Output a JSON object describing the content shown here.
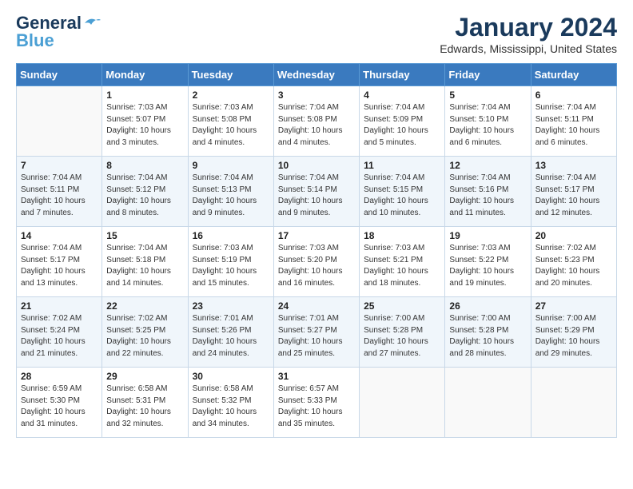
{
  "logo": {
    "line1": "General",
    "line2": "Blue"
  },
  "title": "January 2024",
  "location": "Edwards, Mississippi, United States",
  "days_header": [
    "Sunday",
    "Monday",
    "Tuesday",
    "Wednesday",
    "Thursday",
    "Friday",
    "Saturday"
  ],
  "weeks": [
    [
      {
        "day": "",
        "info": ""
      },
      {
        "day": "1",
        "info": "Sunrise: 7:03 AM\nSunset: 5:07 PM\nDaylight: 10 hours\nand 3 minutes."
      },
      {
        "day": "2",
        "info": "Sunrise: 7:03 AM\nSunset: 5:08 PM\nDaylight: 10 hours\nand 4 minutes."
      },
      {
        "day": "3",
        "info": "Sunrise: 7:04 AM\nSunset: 5:08 PM\nDaylight: 10 hours\nand 4 minutes."
      },
      {
        "day": "4",
        "info": "Sunrise: 7:04 AM\nSunset: 5:09 PM\nDaylight: 10 hours\nand 5 minutes."
      },
      {
        "day": "5",
        "info": "Sunrise: 7:04 AM\nSunset: 5:10 PM\nDaylight: 10 hours\nand 6 minutes."
      },
      {
        "day": "6",
        "info": "Sunrise: 7:04 AM\nSunset: 5:11 PM\nDaylight: 10 hours\nand 6 minutes."
      }
    ],
    [
      {
        "day": "7",
        "info": "Sunrise: 7:04 AM\nSunset: 5:11 PM\nDaylight: 10 hours\nand 7 minutes."
      },
      {
        "day": "8",
        "info": "Sunrise: 7:04 AM\nSunset: 5:12 PM\nDaylight: 10 hours\nand 8 minutes."
      },
      {
        "day": "9",
        "info": "Sunrise: 7:04 AM\nSunset: 5:13 PM\nDaylight: 10 hours\nand 9 minutes."
      },
      {
        "day": "10",
        "info": "Sunrise: 7:04 AM\nSunset: 5:14 PM\nDaylight: 10 hours\nand 9 minutes."
      },
      {
        "day": "11",
        "info": "Sunrise: 7:04 AM\nSunset: 5:15 PM\nDaylight: 10 hours\nand 10 minutes."
      },
      {
        "day": "12",
        "info": "Sunrise: 7:04 AM\nSunset: 5:16 PM\nDaylight: 10 hours\nand 11 minutes."
      },
      {
        "day": "13",
        "info": "Sunrise: 7:04 AM\nSunset: 5:17 PM\nDaylight: 10 hours\nand 12 minutes."
      }
    ],
    [
      {
        "day": "14",
        "info": "Sunrise: 7:04 AM\nSunset: 5:17 PM\nDaylight: 10 hours\nand 13 minutes."
      },
      {
        "day": "15",
        "info": "Sunrise: 7:04 AM\nSunset: 5:18 PM\nDaylight: 10 hours\nand 14 minutes."
      },
      {
        "day": "16",
        "info": "Sunrise: 7:03 AM\nSunset: 5:19 PM\nDaylight: 10 hours\nand 15 minutes."
      },
      {
        "day": "17",
        "info": "Sunrise: 7:03 AM\nSunset: 5:20 PM\nDaylight: 10 hours\nand 16 minutes."
      },
      {
        "day": "18",
        "info": "Sunrise: 7:03 AM\nSunset: 5:21 PM\nDaylight: 10 hours\nand 18 minutes."
      },
      {
        "day": "19",
        "info": "Sunrise: 7:03 AM\nSunset: 5:22 PM\nDaylight: 10 hours\nand 19 minutes."
      },
      {
        "day": "20",
        "info": "Sunrise: 7:02 AM\nSunset: 5:23 PM\nDaylight: 10 hours\nand 20 minutes."
      }
    ],
    [
      {
        "day": "21",
        "info": "Sunrise: 7:02 AM\nSunset: 5:24 PM\nDaylight: 10 hours\nand 21 minutes."
      },
      {
        "day": "22",
        "info": "Sunrise: 7:02 AM\nSunset: 5:25 PM\nDaylight: 10 hours\nand 22 minutes."
      },
      {
        "day": "23",
        "info": "Sunrise: 7:01 AM\nSunset: 5:26 PM\nDaylight: 10 hours\nand 24 minutes."
      },
      {
        "day": "24",
        "info": "Sunrise: 7:01 AM\nSunset: 5:27 PM\nDaylight: 10 hours\nand 25 minutes."
      },
      {
        "day": "25",
        "info": "Sunrise: 7:00 AM\nSunset: 5:28 PM\nDaylight: 10 hours\nand 27 minutes."
      },
      {
        "day": "26",
        "info": "Sunrise: 7:00 AM\nSunset: 5:28 PM\nDaylight: 10 hours\nand 28 minutes."
      },
      {
        "day": "27",
        "info": "Sunrise: 7:00 AM\nSunset: 5:29 PM\nDaylight: 10 hours\nand 29 minutes."
      }
    ],
    [
      {
        "day": "28",
        "info": "Sunrise: 6:59 AM\nSunset: 5:30 PM\nDaylight: 10 hours\nand 31 minutes."
      },
      {
        "day": "29",
        "info": "Sunrise: 6:58 AM\nSunset: 5:31 PM\nDaylight: 10 hours\nand 32 minutes."
      },
      {
        "day": "30",
        "info": "Sunrise: 6:58 AM\nSunset: 5:32 PM\nDaylight: 10 hours\nand 34 minutes."
      },
      {
        "day": "31",
        "info": "Sunrise: 6:57 AM\nSunset: 5:33 PM\nDaylight: 10 hours\nand 35 minutes."
      },
      {
        "day": "",
        "info": ""
      },
      {
        "day": "",
        "info": ""
      },
      {
        "day": "",
        "info": ""
      }
    ]
  ]
}
